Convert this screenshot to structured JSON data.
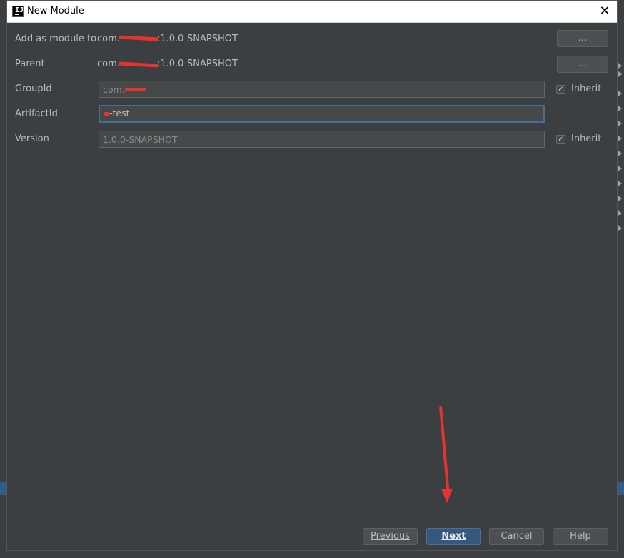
{
  "dialog": {
    "title": "New Module",
    "close_glyph": "✕"
  },
  "form": {
    "add_as_module_label": "Add as module to",
    "add_as_module_value_prefix": "com.",
    "add_as_module_value_suffix": ":1.0.0-SNAPSHOT",
    "parent_label": "Parent",
    "parent_value_prefix": "com.",
    "parent_value_suffix": ":1.0.0-SNAPSHOT",
    "browse_label": "...",
    "groupid_label": "GroupId",
    "groupid_value": "com.l",
    "artifactid_label": "ArtifactId",
    "artifactid_value": "-test",
    "version_label": "Version",
    "version_value": "1.0.0-SNAPSHOT",
    "inherit_label": "Inherit",
    "inherit_checked": true
  },
  "footer": {
    "previous_label": "Previous",
    "next_label": "Next",
    "cancel_label": "Cancel",
    "help_label": "Help"
  },
  "annotation": {
    "color": "#e8322d"
  }
}
